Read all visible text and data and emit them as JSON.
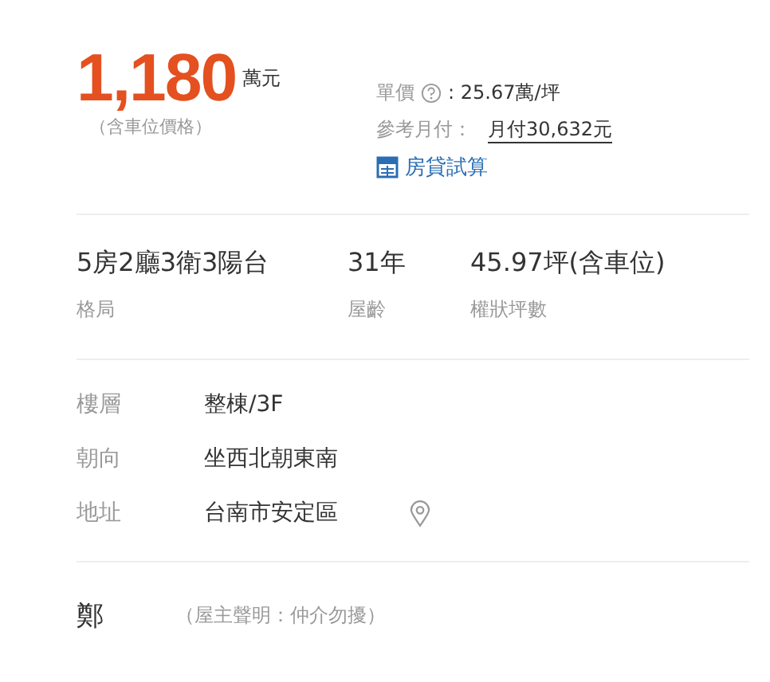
{
  "price": {
    "amount": "1,180",
    "unit": "萬元",
    "note": "（含車位價格）"
  },
  "unit_price": {
    "label": "單價",
    "separator": ":",
    "value": "25.67萬/坪"
  },
  "monthly": {
    "label": "參考月付：",
    "link": "月付30,632元"
  },
  "loan_link": "房貸試算",
  "stats": [
    {
      "value": "5房2廳3衛3陽台",
      "label": "格局"
    },
    {
      "value": "31年",
      "label": "屋齡"
    },
    {
      "value": "45.97坪(含車位)",
      "label": "權狀坪數"
    }
  ],
  "details": [
    {
      "label": "樓層",
      "value": "整棟/3F",
      "map_pin": false
    },
    {
      "label": "朝向",
      "value": "坐西北朝東南",
      "map_pin": false
    },
    {
      "label": "地址",
      "value": "台南市安定區",
      "map_pin": true
    }
  ],
  "owner": {
    "name": "鄭",
    "note": "（屋主聲明：仲介勿擾）"
  }
}
